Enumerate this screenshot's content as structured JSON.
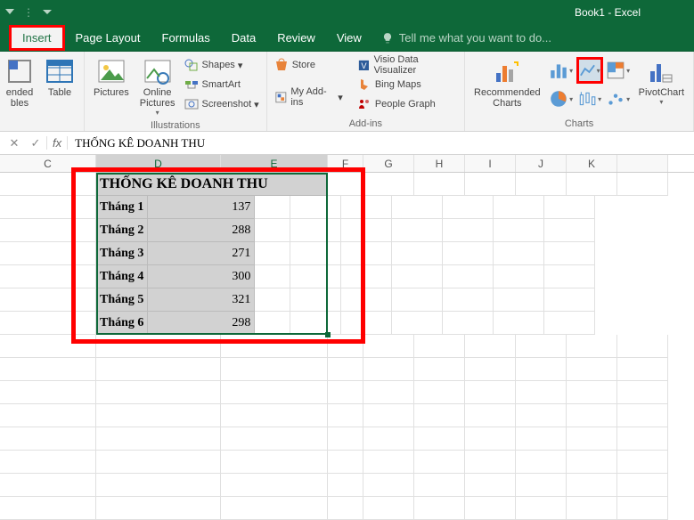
{
  "app_title": "Book1 - Excel",
  "tabs": {
    "insert": "Insert",
    "page_layout": "Page Layout",
    "formulas": "Formulas",
    "data": "Data",
    "review": "Review",
    "view": "View"
  },
  "tell_me": "Tell me what you want to do...",
  "ribbon": {
    "tables": {
      "recommended": "ended\nbles",
      "table": "Table",
      "label": ""
    },
    "illustrations": {
      "pictures": "Pictures",
      "online_pictures": "Online\nPictures",
      "shapes": "Shapes",
      "smartart": "SmartArt",
      "screenshot": "Screenshot",
      "label": "Illustrations"
    },
    "addins": {
      "store": "Store",
      "my_addins": "My Add-ins",
      "visio": "Visio Data Visualizer",
      "bing": "Bing Maps",
      "people": "People Graph",
      "label": "Add-ins"
    },
    "charts": {
      "recommended": "Recommended\nCharts",
      "pivot": "PivotChart",
      "label": "Charts"
    }
  },
  "formula_bar": {
    "fx": "fx",
    "value": "THỐNG KÊ DOANH THU"
  },
  "columns": [
    "C",
    "D",
    "E",
    "F",
    "G",
    "H",
    "I",
    "J",
    "K"
  ],
  "selected_cols": [
    "D",
    "E"
  ],
  "table": {
    "title": "THỐNG KÊ DOANH THU",
    "rows": [
      {
        "label": "Tháng 1",
        "value": "137"
      },
      {
        "label": "Tháng 2",
        "value": "288"
      },
      {
        "label": "Tháng 3",
        "value": "271"
      },
      {
        "label": "Tháng 4",
        "value": "300"
      },
      {
        "label": "Tháng 5",
        "value": "321"
      },
      {
        "label": "Tháng 6",
        "value": "298"
      }
    ]
  },
  "chart_data": {
    "type": "table",
    "title": "THỐNG KÊ DOANH THU",
    "categories": [
      "Tháng 1",
      "Tháng 2",
      "Tháng 3",
      "Tháng 4",
      "Tháng 5",
      "Tháng 6"
    ],
    "values": [
      137,
      288,
      271,
      300,
      321,
      298
    ]
  }
}
